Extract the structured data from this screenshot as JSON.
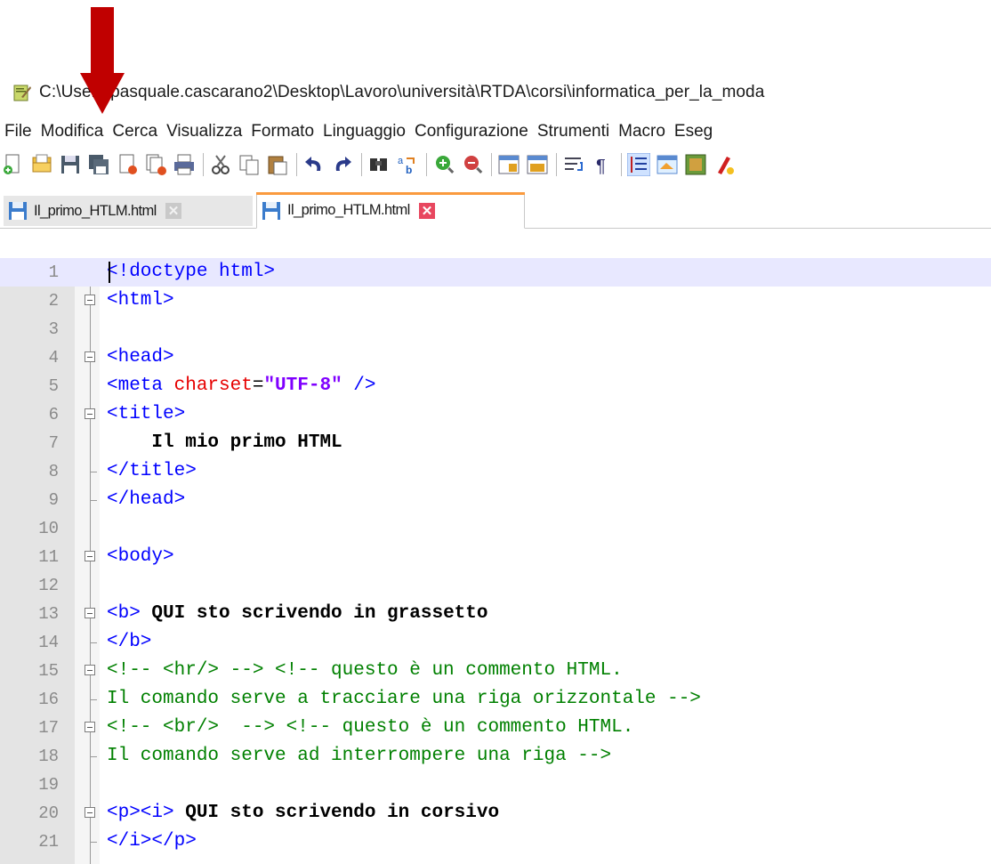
{
  "window": {
    "title": "C:\\Users\\pasquale.cascarano2\\Desktop\\Lavoro\\università\\RTDA\\corsi\\informatica_per_la_moda"
  },
  "menu": [
    "File",
    "Modifica",
    "Cerca",
    "Visualizza",
    "Formato",
    "Linguaggio",
    "Configurazione",
    "Strumenti",
    "Macro",
    "Eseg"
  ],
  "toolbar_icons": [
    "new-file-icon",
    "open-file-icon",
    "save-icon",
    "save-all-icon",
    "close-icon",
    "close-all-icon",
    "print-icon",
    "cut-icon",
    "copy-icon",
    "paste-icon",
    "undo-icon",
    "redo-icon",
    "find-icon",
    "replace-icon",
    "zoom-in-icon",
    "zoom-out-icon",
    "sync-vertical-icon",
    "sync-horizontal-icon",
    "word-wrap-icon",
    "show-all-chars-icon",
    "indent-guide-icon",
    "document-map-icon",
    "function-list-icon",
    "record-macro-icon"
  ],
  "tabs": [
    {
      "label": "Il_primo_HTLM.html",
      "active": false
    },
    {
      "label": "Il_primo_HTLM.html",
      "active": true
    }
  ],
  "editor": {
    "current_line": 1,
    "lines": [
      {
        "n": "1",
        "fold": "none",
        "tokens": [
          {
            "c": "tag",
            "t": "<!doctype html>"
          }
        ]
      },
      {
        "n": "2",
        "fold": "open",
        "tokens": [
          {
            "c": "tag",
            "t": "<html>"
          }
        ]
      },
      {
        "n": "3",
        "fold": "none",
        "tokens": []
      },
      {
        "n": "4",
        "fold": "open",
        "tokens": [
          {
            "c": "tag",
            "t": "<head>"
          }
        ]
      },
      {
        "n": "5",
        "fold": "none",
        "tokens": [
          {
            "c": "tag",
            "t": "<meta "
          },
          {
            "c": "attr",
            "t": "charset"
          },
          {
            "c": "plain",
            "t": "="
          },
          {
            "c": "val",
            "t": "\"UTF-8\""
          },
          {
            "c": "tag",
            "t": " />"
          }
        ]
      },
      {
        "n": "6",
        "fold": "open",
        "tokens": [
          {
            "c": "tag",
            "t": "<title>"
          }
        ]
      },
      {
        "n": "7",
        "fold": "none",
        "tokens": [
          {
            "c": "txt",
            "t": "    Il mio primo HTML"
          }
        ]
      },
      {
        "n": "8",
        "fold": "end",
        "tokens": [
          {
            "c": "tag",
            "t": "</title>"
          }
        ]
      },
      {
        "n": "9",
        "fold": "end",
        "tokens": [
          {
            "c": "tag",
            "t": "</head>"
          }
        ]
      },
      {
        "n": "10",
        "fold": "none",
        "tokens": []
      },
      {
        "n": "11",
        "fold": "open",
        "tokens": [
          {
            "c": "tag",
            "t": "<body>"
          }
        ]
      },
      {
        "n": "12",
        "fold": "none",
        "tokens": []
      },
      {
        "n": "13",
        "fold": "open",
        "tokens": [
          {
            "c": "tag",
            "t": "<b>"
          },
          {
            "c": "txt",
            "t": " QUI sto scrivendo in grassetto"
          }
        ]
      },
      {
        "n": "14",
        "fold": "end",
        "tokens": [
          {
            "c": "tag",
            "t": "</b>"
          }
        ]
      },
      {
        "n": "15",
        "fold": "open",
        "tokens": [
          {
            "c": "cmt",
            "t": "<!-- <hr/> --> <!-- questo è un commento HTML."
          }
        ]
      },
      {
        "n": "16",
        "fold": "end",
        "tokens": [
          {
            "c": "cmt",
            "t": "Il comando serve a tracciare una riga orizzontale -->"
          }
        ]
      },
      {
        "n": "17",
        "fold": "open",
        "tokens": [
          {
            "c": "cmt",
            "t": "<!-- <br/>  --> <!-- questo è un commento HTML."
          }
        ]
      },
      {
        "n": "18",
        "fold": "end",
        "tokens": [
          {
            "c": "cmt",
            "t": "Il comando serve ad interrompere una riga -->"
          }
        ]
      },
      {
        "n": "19",
        "fold": "none",
        "tokens": []
      },
      {
        "n": "20",
        "fold": "open",
        "tokens": [
          {
            "c": "tag",
            "t": "<p><i>"
          },
          {
            "c": "txt",
            "t": " QUI sto scrivendo in corsivo"
          }
        ]
      },
      {
        "n": "21",
        "fold": "end",
        "tokens": [
          {
            "c": "tag",
            "t": "</i></p>"
          }
        ]
      }
    ]
  },
  "colors": {
    "arrow": "#c00000",
    "tag": "#0000ff",
    "attribute": "#e60000",
    "value": "#8000ff",
    "comment": "#008000",
    "active_tab_accent": "#fa9a3e",
    "current_line": "#e8e8ff"
  }
}
